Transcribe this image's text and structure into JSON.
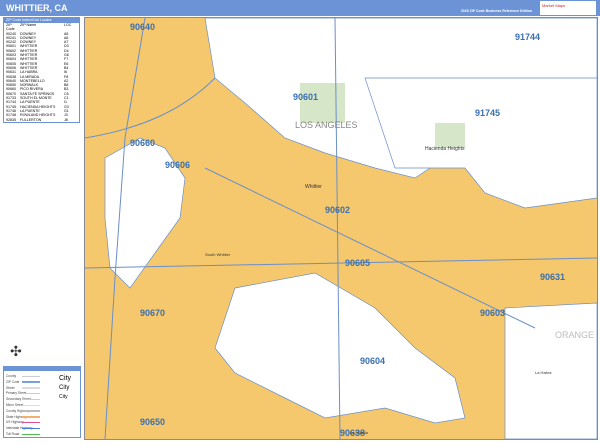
{
  "header": {
    "title": "WHITTIER, CA",
    "edition": "2026 ZIP Code Business Reference Edition",
    "logo": "Market Maps"
  },
  "index": {
    "title": "ZIP Code Index/Grid Locator",
    "columns": [
      "ZIP Code",
      "ZIP Name",
      "LOC"
    ],
    "rows": [
      [
        "90240",
        "DOWNEY",
        "A5"
      ],
      [
        "90241",
        "DOWNEY",
        "A6"
      ],
      [
        "90242",
        "DOWNEY",
        "A7"
      ],
      [
        "90601",
        "WHITTIER",
        "D3"
      ],
      [
        "90602",
        "WHITTIER",
        "D4"
      ],
      [
        "90603",
        "WHITTIER",
        "G6"
      ],
      [
        "90604",
        "WHITTIER",
        "F7"
      ],
      [
        "90605",
        "WHITTIER",
        "E6"
      ],
      [
        "90606",
        "WHITTIER",
        "B4"
      ],
      [
        "90631",
        "LA HABRA",
        "I6"
      ],
      [
        "90638",
        "LA MIRADA",
        "F8"
      ],
      [
        "90640",
        "MONTEBELLO",
        "A2"
      ],
      [
        "90650",
        "NORWALK",
        "B8"
      ],
      [
        "90660",
        "PICO RIVERA",
        "B3"
      ],
      [
        "90670",
        "SANTA FE SPRINGS",
        "C6"
      ],
      [
        "91733",
        "SOUTH EL MONTE",
        "C1"
      ],
      [
        "91744",
        "LA PUENTE",
        "I1"
      ],
      [
        "91745",
        "HACIENDA HEIGHTS",
        "G3"
      ],
      [
        "91746",
        "LA PUENTE",
        "G1"
      ],
      [
        "91748",
        "ROWLAND HEIGHTS",
        "J3"
      ],
      [
        "92835",
        "FULLERTON",
        "J8"
      ]
    ]
  },
  "legend": {
    "items": [
      "County",
      "ZIP Code",
      "Street",
      "Primary Street",
      "Secondary Street",
      "Minor Street",
      "County Highway",
      "State Highway",
      "US Highway",
      "Interstate Highway",
      "Toll Road"
    ],
    "city_labels": [
      "City",
      "City",
      "City"
    ]
  },
  "map": {
    "zips": [
      "90640",
      "91744",
      "90601",
      "91745",
      "90660",
      "90606",
      "90602",
      "90605",
      "90631",
      "90670",
      "90603",
      "90604",
      "90650",
      "90638"
    ],
    "counties": [
      "LOS ANGELES",
      "ORANGE"
    ],
    "places": [
      "Hacienda Heights",
      "Whittier",
      "South Whittier",
      "La Habra",
      "La Mirada"
    ]
  },
  "colors": {
    "header": "#6b93d6",
    "zip_fill": "#f5c86e",
    "white_area": "#ffffff",
    "zip_label": "#3a6fb0"
  }
}
